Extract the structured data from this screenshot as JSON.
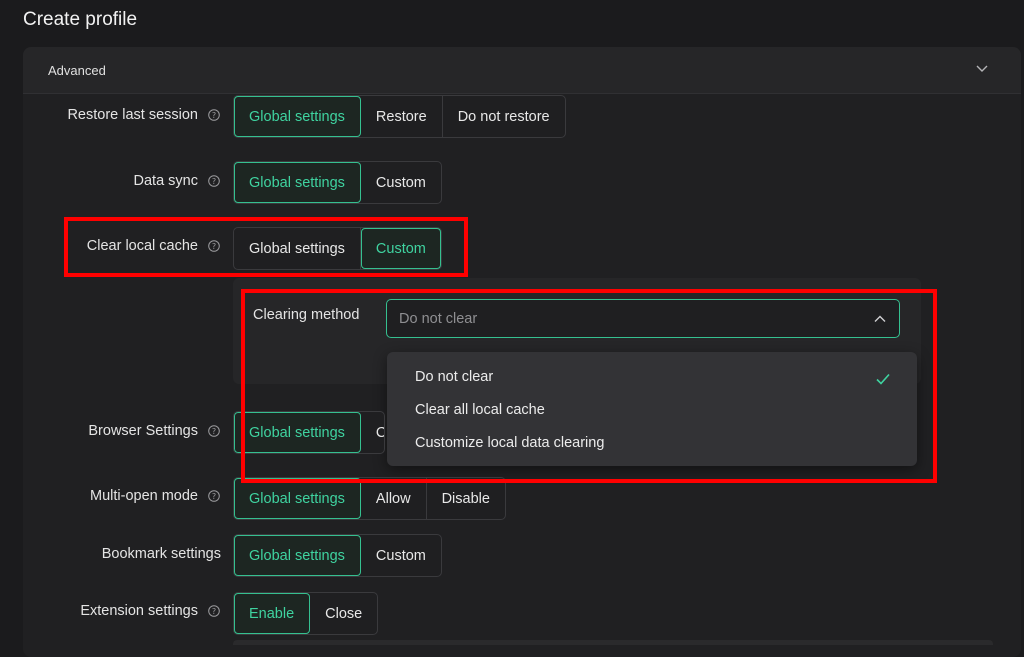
{
  "page": {
    "title": "Create profile"
  },
  "panel": {
    "title": "Advanced"
  },
  "rows": {
    "restore_last_session": {
      "label": "Restore last session",
      "options": [
        "Global settings",
        "Restore",
        "Do not restore"
      ]
    },
    "data_sync": {
      "label": "Data sync",
      "options": [
        "Global settings",
        "Custom"
      ]
    },
    "clear_local_cache": {
      "label": "Clear local cache",
      "options": [
        "Global settings",
        "Custom"
      ]
    },
    "browser_settings": {
      "label": "Browser Settings",
      "options": [
        "Global settings",
        "C"
      ]
    },
    "multi_open_mode": {
      "label": "Multi-open mode",
      "options": [
        "Global settings",
        "Allow",
        "Disable"
      ]
    },
    "bookmark_settings": {
      "label": "Bookmark settings",
      "options": [
        "Global settings",
        "Custom"
      ]
    },
    "extension_settings": {
      "label": "Extension settings",
      "options": [
        "Enable",
        "Close"
      ]
    }
  },
  "clearing": {
    "label": "Clearing method",
    "selected": "Do not clear",
    "options": [
      "Do not clear",
      "Clear all local cache",
      "Customize local data clearing"
    ]
  },
  "colors": {
    "accent": "#3fd3a0",
    "highlight": "#ff0000",
    "background": "#1b1b1d"
  },
  "icons": {
    "help": "question-circle-icon",
    "collapse": "chevron-down-icon",
    "select": "chevron-up-icon",
    "check": "check-icon"
  }
}
